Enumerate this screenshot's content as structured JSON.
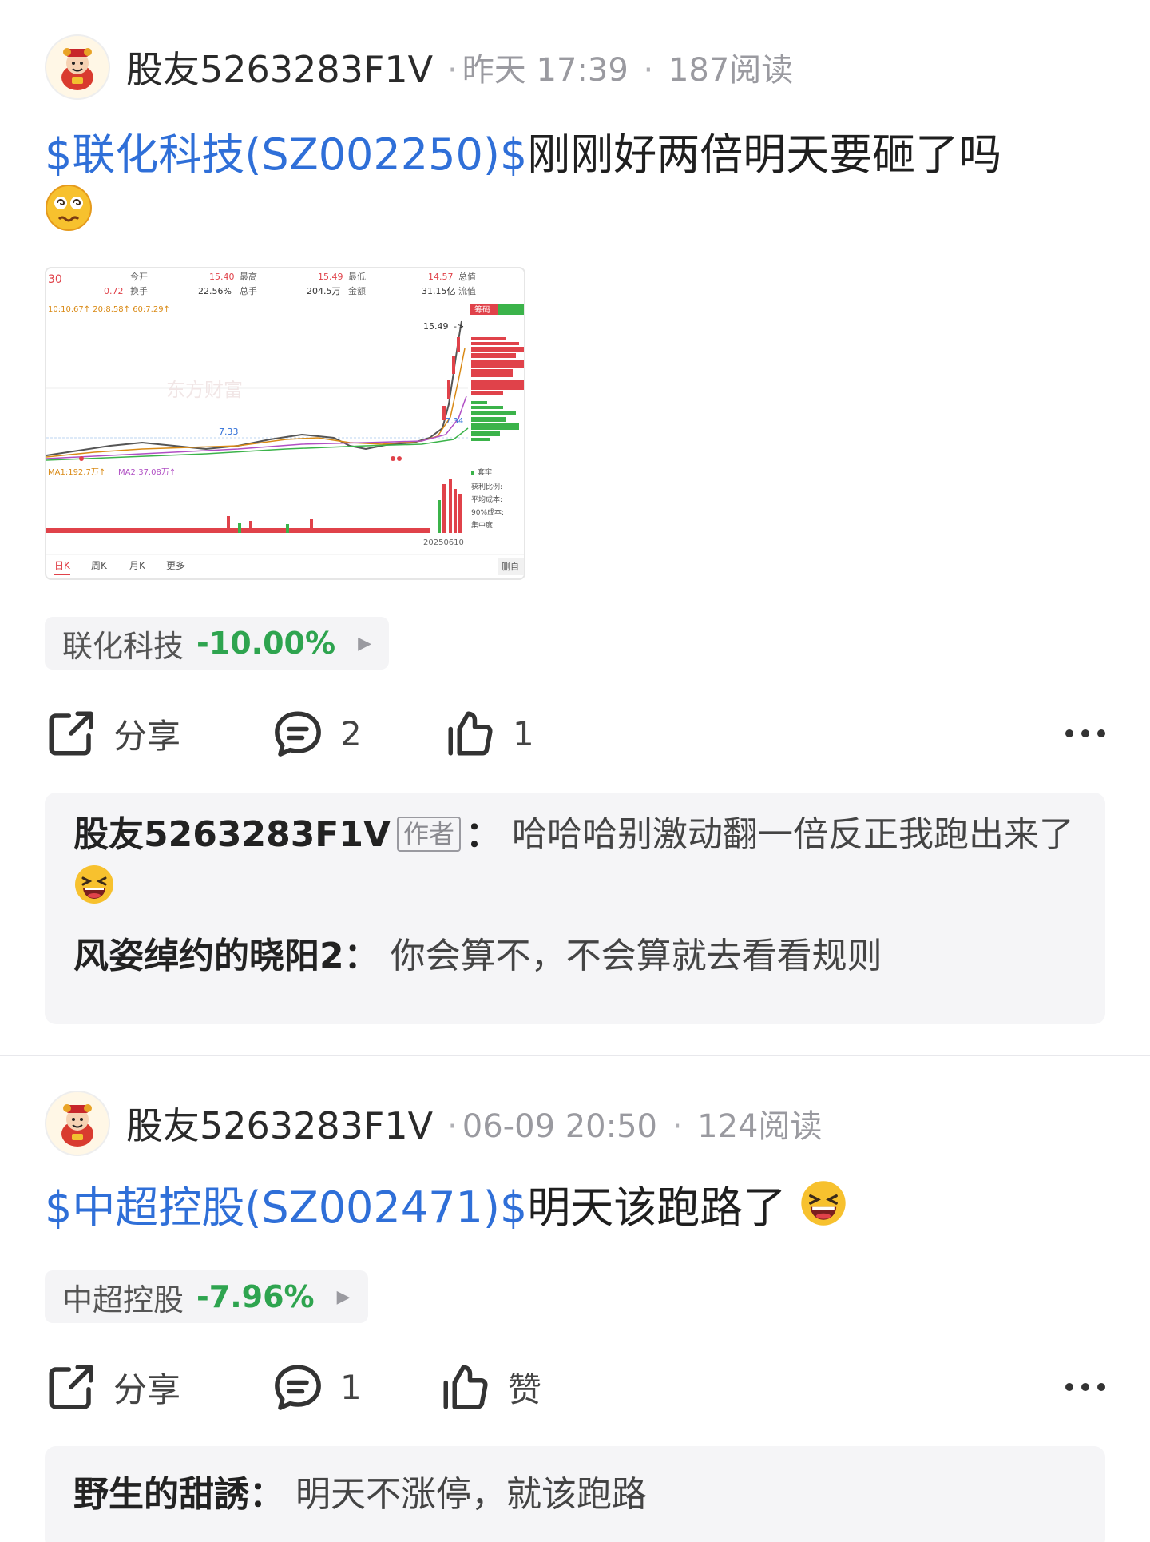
{
  "posts": [
    {
      "username": "股友5263283F1V",
      "time": "昨天 17:39",
      "reads": "187阅读",
      "stock_link": "$联化科技(SZ002250)$",
      "text": "刚刚好两倍明天要砸了吗",
      "chart_image": {
        "header_row1": [
          "今开",
          "15.40",
          "最高",
          "15.49",
          "最低",
          "14.57",
          "总值"
        ],
        "header_row2": [
          "0.72",
          "换手",
          "22.56%",
          "总手",
          "204.5万",
          "金额",
          "31.15亿",
          "流值"
        ],
        "ma_line": "10:10.67↑ 20:8.58↑ 60:7.29↑",
        "left_edge": "30",
        "price_high_label": "15.49",
        "price_low_label": "7.33",
        "price_mid_label": "7.34",
        "watermark": "东方财富",
        "vol_ma_1": "MA1:192.7万↑",
        "vol_ma_2": "MA2:37.08万↑",
        "date_label": "20250610",
        "side_tab": "筹码",
        "side_legend": [
          "套牢",
          "获利比例:",
          "平均成本:",
          "90%成本:",
          "集中度:"
        ],
        "tabs": [
          "日K",
          "周K",
          "月K",
          "更多"
        ],
        "corner": "删自"
      },
      "ticker": {
        "name": "联化科技",
        "change": "-10.00%",
        "color": "#2ea44f"
      },
      "actions": {
        "share": "分享",
        "comments": "2",
        "likes": "1"
      },
      "comments": [
        {
          "author": "股友5263283F1V",
          "tag": "作者",
          "text": "哈哈哈别激动翻一倍反正我跑出来了"
        },
        {
          "author": "风姿绰约的晓阳2",
          "text": "你会算不，不会算就去看看规则"
        }
      ]
    },
    {
      "username": "股友5263283F1V",
      "time": "06-09 20:50",
      "reads": "124阅读",
      "stock_link": "$中超控股(SZ002471)$",
      "text": "明天该跑路了",
      "ticker": {
        "name": "中超控股",
        "change": "-7.96%",
        "color": "#2ea44f"
      },
      "actions": {
        "share": "分享",
        "comments": "1",
        "likes": "赞"
      },
      "comments": [
        {
          "author": "野生的甜誘",
          "text": "明天不涨停，就该跑路"
        }
      ]
    }
  ],
  "colors": {
    "link": "#2f6fd8",
    "down": "#2ea44f",
    "up": "#e0424a",
    "comment_bg": "#f5f5f7"
  }
}
